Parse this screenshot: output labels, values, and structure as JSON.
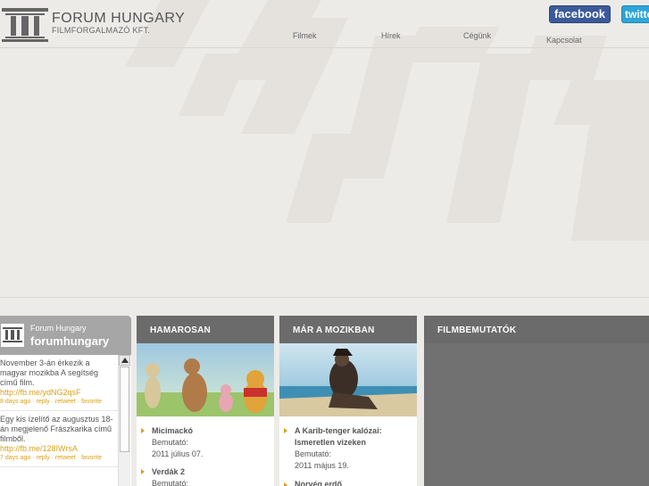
{
  "brand": {
    "title": "FORUM HUNGARY",
    "subtitle": "FILMFORGALMAZÓ KFT."
  },
  "nav": [
    {
      "label": "Filmek"
    },
    {
      "label": "Hírek"
    },
    {
      "label": "Cégünk"
    },
    {
      "label": "Kapcsolat"
    }
  ],
  "social": {
    "facebook": "facebook",
    "twitter": "twitter"
  },
  "twitter_widget": {
    "name": "Forum Hungary",
    "handle": "forumhungary",
    "tweets": [
      {
        "text": "November 3-án érkezik a magyar mozikba A segítség című film.",
        "link": "http://fb.me/ydNG2qsF",
        "meta_time": "8 days ago",
        "meta_reply": "reply",
        "meta_retweet": "retweet",
        "meta_favorite": "favorite"
      },
      {
        "text": "Egy kis ízelítő az augusztus 18-án megjelenő Frászkarika című filmből.",
        "link": "http://fb.me/128IWrsA",
        "meta_time": "7 days ago",
        "meta_reply": "reply",
        "meta_retweet": "retweet",
        "meta_favorite": "favorite"
      }
    ]
  },
  "coming_soon": {
    "heading": "HAMAROSAN",
    "items": [
      {
        "title": "Micimackó",
        "label": "Bemutató:",
        "date": "2011 július 07."
      },
      {
        "title": "Verdák 2",
        "label": "Bemutató:",
        "date": ""
      }
    ]
  },
  "now_showing": {
    "heading": "MÁR A MOZIKBAN",
    "items": [
      {
        "title_line1": "A Karib-tenger kalózai:",
        "title_line2": "Ismeretlen vizeken",
        "label": "Bemutató:",
        "date": "2011 május 19."
      },
      {
        "title_line1": "Norvég erdő",
        "title_line2": "",
        "label": "",
        "date": ""
      }
    ]
  },
  "premieres": {
    "heading": "FILMBEMUTATÓK"
  },
  "colors": {
    "accent": "#d9a21a",
    "header_bar": "#6b6b6b",
    "facebook": "#3b5a9a",
    "twitter": "#2ea5d8"
  }
}
